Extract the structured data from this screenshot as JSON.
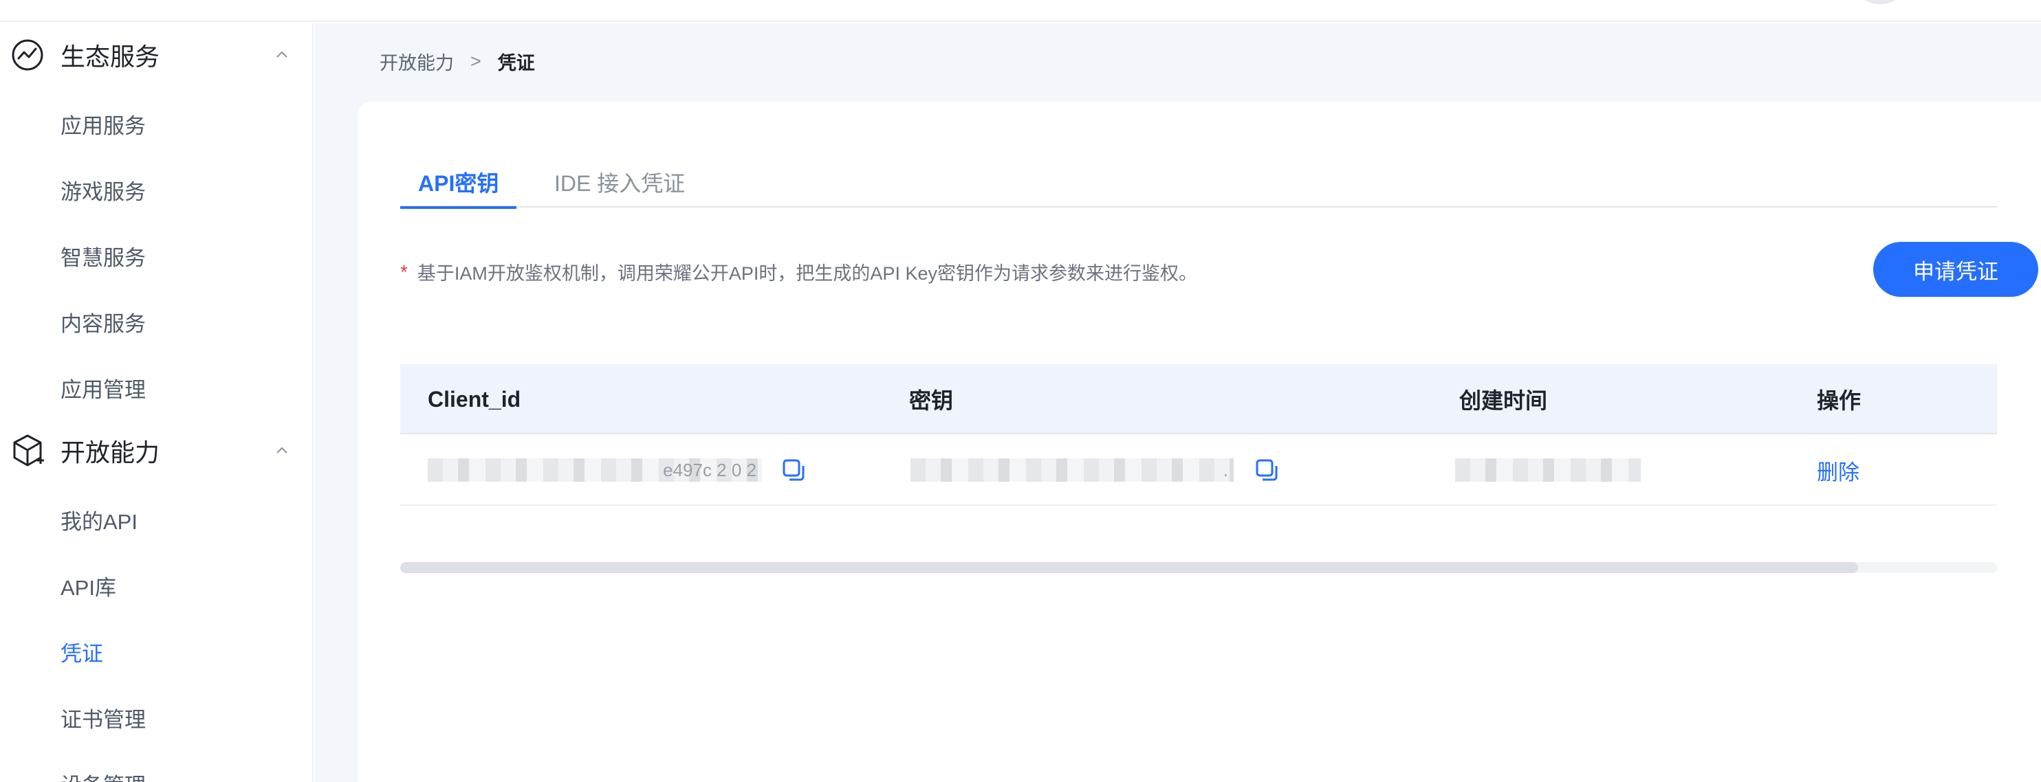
{
  "sidebar": {
    "groups": [
      {
        "label": "生态服务",
        "items": [
          "应用服务",
          "游戏服务",
          "智慧服务",
          "内容服务",
          "应用管理"
        ]
      },
      {
        "label": "开放能力",
        "items": [
          "我的API",
          "API库",
          "凭证",
          "证书管理",
          "设备管理"
        ]
      }
    ],
    "active_item": "凭证"
  },
  "breadcrumb": {
    "parent": "开放能力",
    "separator": ">",
    "current": "凭证"
  },
  "tabs": [
    {
      "label": "API密钥",
      "active": true
    },
    {
      "label": "IDE 接入凭证",
      "active": false
    }
  ],
  "notice": {
    "marker": "*",
    "text": "基于IAM开放鉴权机制，调用荣耀公开API时，把生成的API Key密钥作为请求参数来进行鉴权。"
  },
  "apply_button": "申请凭证",
  "table": {
    "headers": [
      "Client_id",
      "密钥",
      "创建时间",
      "操作"
    ],
    "rows": [
      {
        "client_id": "e497c 2 0 2",
        "secret": ".",
        "created": "",
        "action": "删除"
      }
    ]
  },
  "colors": {
    "accent": "#256fff",
    "required_marker": "#e8373a",
    "page_background": "#f3f6fb",
    "table_header_bg": "#eef3fc"
  },
  "icons": {
    "eco_services": "trend-chart-circle-icon",
    "open_capabilities": "cube-plus-icon",
    "collapse": "chevron-up-icon",
    "copy": "copy-icon"
  }
}
